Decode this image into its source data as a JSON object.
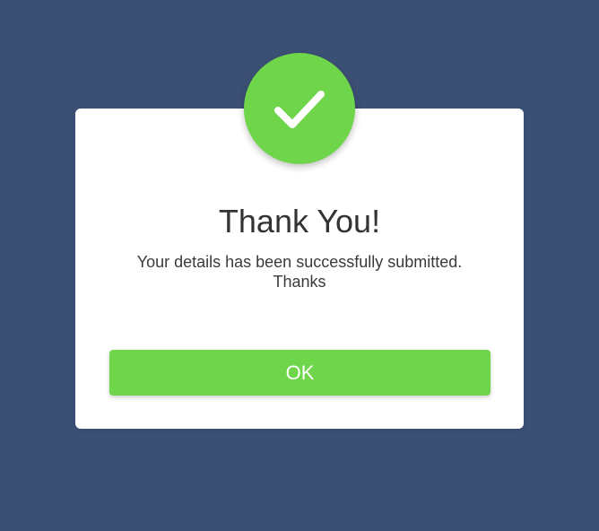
{
  "dialog": {
    "icon": "check-icon",
    "title": "Thank You!",
    "message_line1": "Your details has been successfully submitted.",
    "message_line2": "Thanks",
    "ok_label": "OK"
  },
  "colors": {
    "background": "#3c5076",
    "accent": "#6fd54a",
    "card": "#ffffff",
    "text": "#333333"
  }
}
